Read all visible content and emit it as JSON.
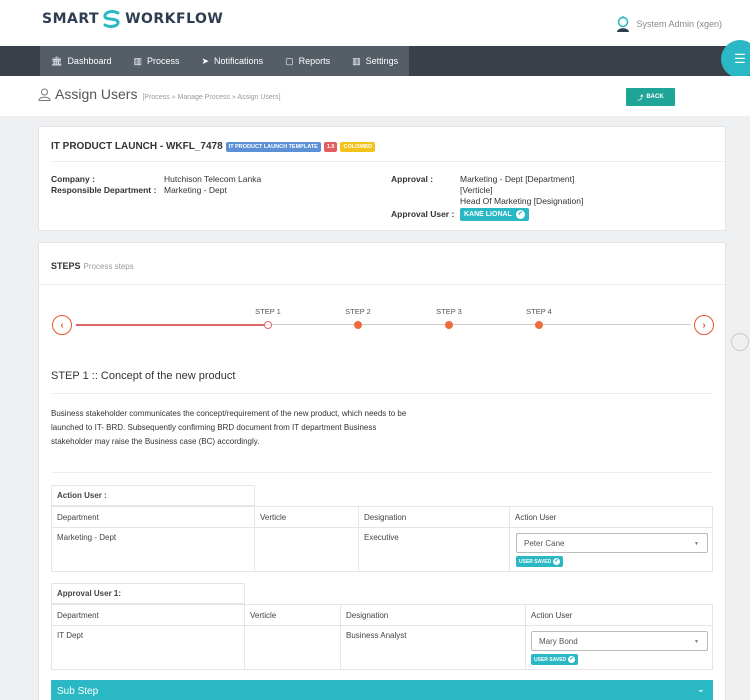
{
  "header": {
    "logo_left": "SMART",
    "logo_right": "WORKFLOW",
    "user_name": "System Admin (xgen)"
  },
  "nav": {
    "items": [
      {
        "label": "Dashboard",
        "icon": "bank-icon"
      },
      {
        "label": "Process",
        "icon": "bar-chart-icon"
      },
      {
        "label": "Notifications",
        "icon": "send-icon"
      },
      {
        "label": "Reports",
        "icon": "file-icon"
      },
      {
        "label": "Settings",
        "icon": "bar-chart-icon"
      }
    ],
    "menu_icon": "hamburger-icon"
  },
  "page": {
    "title": "Assign Users",
    "breadcrumb": "[Process » Manage Process » Assign Users]",
    "back_label": "BACK"
  },
  "process": {
    "title": "IT PRODUCT LAUNCH - WKFL_7478",
    "badges": {
      "template": "IT PRODUCT LAUNCH TEMPLATE",
      "version": "1.0",
      "location": "COLOMBO"
    },
    "company_label": "Company :",
    "company_value": "Hutchison Telecom Lanka",
    "dept_label": "Responsible Department :",
    "dept_value": "Marketing - Dept",
    "approval_label": "Approval :",
    "approval_line1": "Marketing - Dept [Department]",
    "approval_line2": "[Verticle]",
    "approval_line3": "Head Of Marketing [Designation]",
    "approval_user_label": "Approval User :",
    "approval_user_value": "KANE LIONAL"
  },
  "steps": {
    "heading": "STEPS",
    "subheading": "Process steps",
    "labels": [
      "STEP 1",
      "STEP 2",
      "STEP 3",
      "STEP 4"
    ],
    "current_title": "STEP 1 :: Concept of the new product",
    "description": "Business stakeholder communicates the concept/requirement of the new product, which needs to be launched to IT- BRD. Subsequently confirming BRD document from IT department Business stakeholder may raise the Business case (BC) accordingly."
  },
  "action_table": {
    "caption": "Action User :",
    "headers": [
      "Department",
      "Verticle",
      "Designation",
      "Action User"
    ],
    "row": {
      "department": "Marketing - Dept",
      "verticle": "",
      "designation": "Executive",
      "user": "Peter Cane"
    },
    "saved_label": "USER SAVED"
  },
  "approval_table": {
    "caption": "Approval User 1:",
    "headers": [
      "Department",
      "Verticle",
      "Designation",
      "Action User"
    ],
    "row": {
      "department": "IT Dept",
      "verticle": "",
      "designation": "Business Analyst",
      "user": "Mary Bond"
    },
    "saved_label": "USER SAVED"
  },
  "substep": {
    "label": "Sub Step"
  },
  "colors": {
    "accent": "#2ab8c4",
    "nav_bg": "#394049",
    "step_orange": "#ed6c3e",
    "back_green": "#1fa597"
  }
}
